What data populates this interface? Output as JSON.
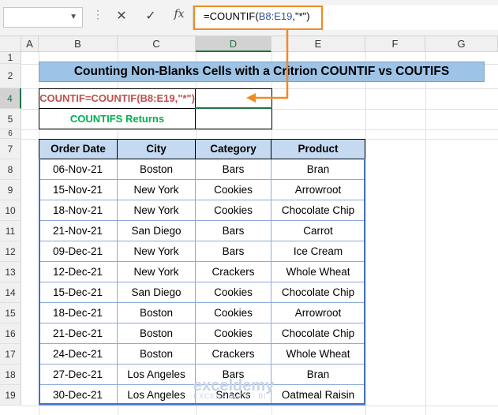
{
  "namebox": {
    "value": ""
  },
  "toolbar": {
    "dots": "⋮",
    "cancel": "✕",
    "enter": "✓",
    "fx": "fx"
  },
  "formula": {
    "prefix": "=COUNTIF(",
    "ref": "B8:E19",
    "suffix": ",\"*\")"
  },
  "columns": [
    "A",
    "B",
    "C",
    "D",
    "E",
    "F",
    "G"
  ],
  "rows": [
    "1",
    "2",
    "4",
    "5",
    "6",
    "7",
    "8",
    "9",
    "10",
    "11",
    "12",
    "13",
    "14",
    "15",
    "16",
    "17",
    "18",
    "19"
  ],
  "title": "Counting  Non-Blanks Cells with a Critrion COUNTIF vs COUTIFS",
  "countif_label": "COUNTIF=COUNTIF(B8:E19,\"*\")",
  "countifs_label": "COUNTIFS Returns",
  "table": {
    "headers": [
      "Order Date",
      "City",
      "Category",
      "Product"
    ],
    "rows": [
      [
        "06-Nov-21",
        "Boston",
        "Bars",
        "Bran"
      ],
      [
        "15-Nov-21",
        "New York",
        "Cookies",
        "Arrowroot"
      ],
      [
        "18-Nov-21",
        "New York",
        "Cookies",
        "Chocolate Chip"
      ],
      [
        "21-Nov-21",
        "San Diego",
        "Bars",
        "Carrot"
      ],
      [
        "09-Dec-21",
        "New York",
        "Bars",
        "Ice Cream"
      ],
      [
        "12-Dec-21",
        "New York",
        "Crackers",
        "Whole Wheat"
      ],
      [
        "15-Dec-21",
        "San Diego",
        "Cookies",
        "Chocolate Chip"
      ],
      [
        "18-Dec-21",
        "Boston",
        "Cookies",
        "Arrowroot"
      ],
      [
        "21-Dec-21",
        "Boston",
        "Cookies",
        "Chocolate Chip"
      ],
      [
        "24-Dec-21",
        "Boston",
        "Crackers",
        "Whole Wheat"
      ],
      [
        "27-Dec-21",
        "Los Angeles",
        "Bars",
        "Bran"
      ],
      [
        "30-Dec-21",
        "Los Angeles",
        "Snacks",
        "Oatmeal Raisin"
      ]
    ]
  },
  "watermark": {
    "name": "exceldemy",
    "tag": "EXCEL · DATA · BI"
  },
  "colors": {
    "accent": "#217346",
    "highlight": "#f08a24",
    "header_fill": "#c5d9f1",
    "title_fill": "#9dc3e6"
  }
}
